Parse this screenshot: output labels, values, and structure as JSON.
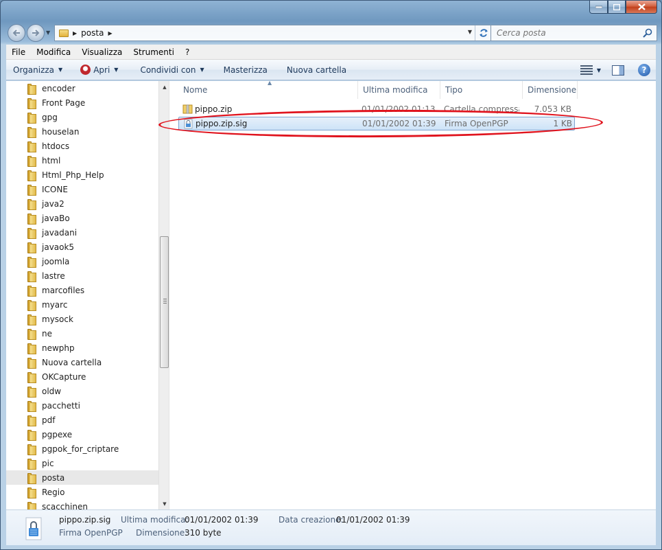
{
  "window": {
    "minimize_icon": "minimize-icon",
    "maximize_icon": "maximize-icon",
    "close_icon": "close-icon"
  },
  "address": {
    "path": [
      "posta"
    ],
    "search_placeholder": "Cerca posta"
  },
  "menu": [
    "File",
    "Modifica",
    "Visualizza",
    "Strumenti",
    "?"
  ],
  "toolbar": {
    "organize": "Organizza",
    "open": "Apri",
    "share": "Condividi con",
    "burn": "Masterizza",
    "new_folder": "Nuova cartella"
  },
  "tree": {
    "items": [
      "encoder",
      "Front Page",
      "gpg",
      "houselan",
      "htdocs",
      "html",
      "Html_Php_Help",
      "ICONE",
      "java2",
      "javaBo",
      "javadani",
      "javaok5",
      "joomla",
      "lastre",
      "marcofiles",
      "myarc",
      "mysock",
      "ne",
      "newphp",
      "Nuova cartella",
      "OKCapture",
      "oldw",
      "pacchetti",
      "pdf",
      "pgpexe",
      "pgpok_for_criptare",
      "pic",
      "posta",
      "Regio",
      "scacchinen"
    ],
    "selected": "posta"
  },
  "columns": {
    "name": "Nome",
    "modified": "Ultima modifica",
    "type": "Tipo",
    "size": "Dimensione"
  },
  "files": [
    {
      "name": "pippo.zip",
      "modified": "01/01/2002 01:13",
      "type": "Cartella compressa",
      "size": "7.053 KB",
      "icon": "zip-folder-icon"
    },
    {
      "name": "pippo.zip.sig",
      "modified": "01/01/2002 01:39",
      "type": "Firma OpenPGP",
      "size": "1 KB",
      "icon": "openpgp-signature-icon"
    }
  ],
  "details": {
    "name": "pippo.zip.sig",
    "type": "Firma OpenPGP",
    "modified_label": "Ultima modifica:",
    "modified_value": "01/01/2002 01:39",
    "size_label": "Dimensione:",
    "size_value": "310 byte",
    "created_label": "Data creazione:",
    "created_value": "01/01/2002 01:39"
  },
  "colors": {
    "highlight_ellipse": "#e0141e",
    "selection": "#cde3f8"
  }
}
